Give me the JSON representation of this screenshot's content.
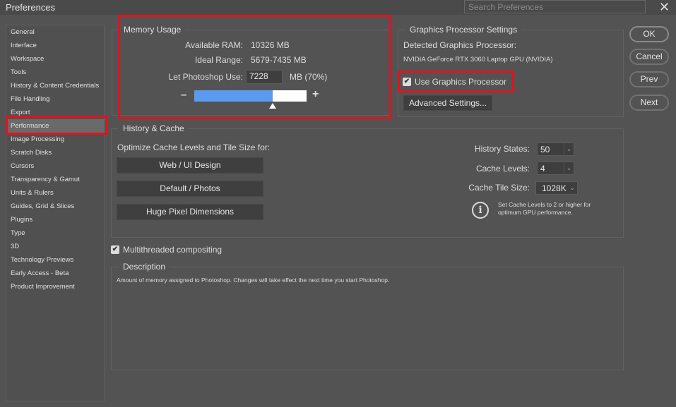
{
  "window": {
    "title": "Preferences",
    "search_placeholder": "Search Preferences",
    "close": "✕"
  },
  "sidebar": {
    "items": [
      {
        "label": "General"
      },
      {
        "label": "Interface"
      },
      {
        "label": "Workspace"
      },
      {
        "label": "Tools"
      },
      {
        "label": "History & Content Credentials"
      },
      {
        "label": "File Handling"
      },
      {
        "label": "Export"
      },
      {
        "label": "Performance",
        "selected": true
      },
      {
        "label": "Image Processing"
      },
      {
        "label": "Scratch Disks"
      },
      {
        "label": "Cursors"
      },
      {
        "label": "Transparency & Gamut"
      },
      {
        "label": "Units & Rulers"
      },
      {
        "label": "Guides, Grid & Slices"
      },
      {
        "label": "Plugins"
      },
      {
        "label": "Type"
      },
      {
        "label": "3D"
      },
      {
        "label": "Technology Previews"
      },
      {
        "label": "Early Access - Beta"
      },
      {
        "label": "Product Improvement"
      }
    ]
  },
  "memory": {
    "title": "Memory Usage",
    "available_label": "Available RAM:",
    "available_value": "10326 MB",
    "ideal_label": "Ideal Range:",
    "ideal_value": "5679-7435 MB",
    "use_label": "Let Photoshop Use:",
    "use_value": "7228",
    "use_unit": "MB (70%)",
    "slider_percent": 70,
    "minus": "–",
    "plus": "+"
  },
  "gpu": {
    "title": "Graphics Processor Settings",
    "detected_label": "Detected Graphics Processor:",
    "detected_value": "NVIDIA GeForce RTX 3060 Laptop GPU (NVIDIA)",
    "use_gpu_label": "Use Graphics Processor",
    "use_gpu_checked": true,
    "advanced_label": "Advanced Settings..."
  },
  "cache": {
    "title": "History & Cache",
    "optimize_label": "Optimize Cache Levels and Tile Size for:",
    "buttons": [
      "Web / UI Design",
      "Default / Photos",
      "Huge Pixel Dimensions"
    ],
    "history_label": "History States:",
    "history_value": "50",
    "levels_label": "Cache Levels:",
    "levels_value": "4",
    "tile_label": "Cache Tile Size:",
    "tile_value": "1028K",
    "info_line1": "Set Cache Levels to 2 or higher for",
    "info_line2": "optimum GPU performance."
  },
  "multithreaded": {
    "label": "Multithreaded compositing",
    "checked": true
  },
  "description": {
    "title": "Description",
    "text": "Amount of memory assigned to Photoshop. Changes will take effect the next time you start Photoshop."
  },
  "actions": {
    "ok": "OK",
    "cancel": "Cancel",
    "prev": "Prev",
    "next": "Next"
  },
  "colors": {
    "highlight": "#e0141e",
    "slider_fill": "#5b9bef"
  }
}
